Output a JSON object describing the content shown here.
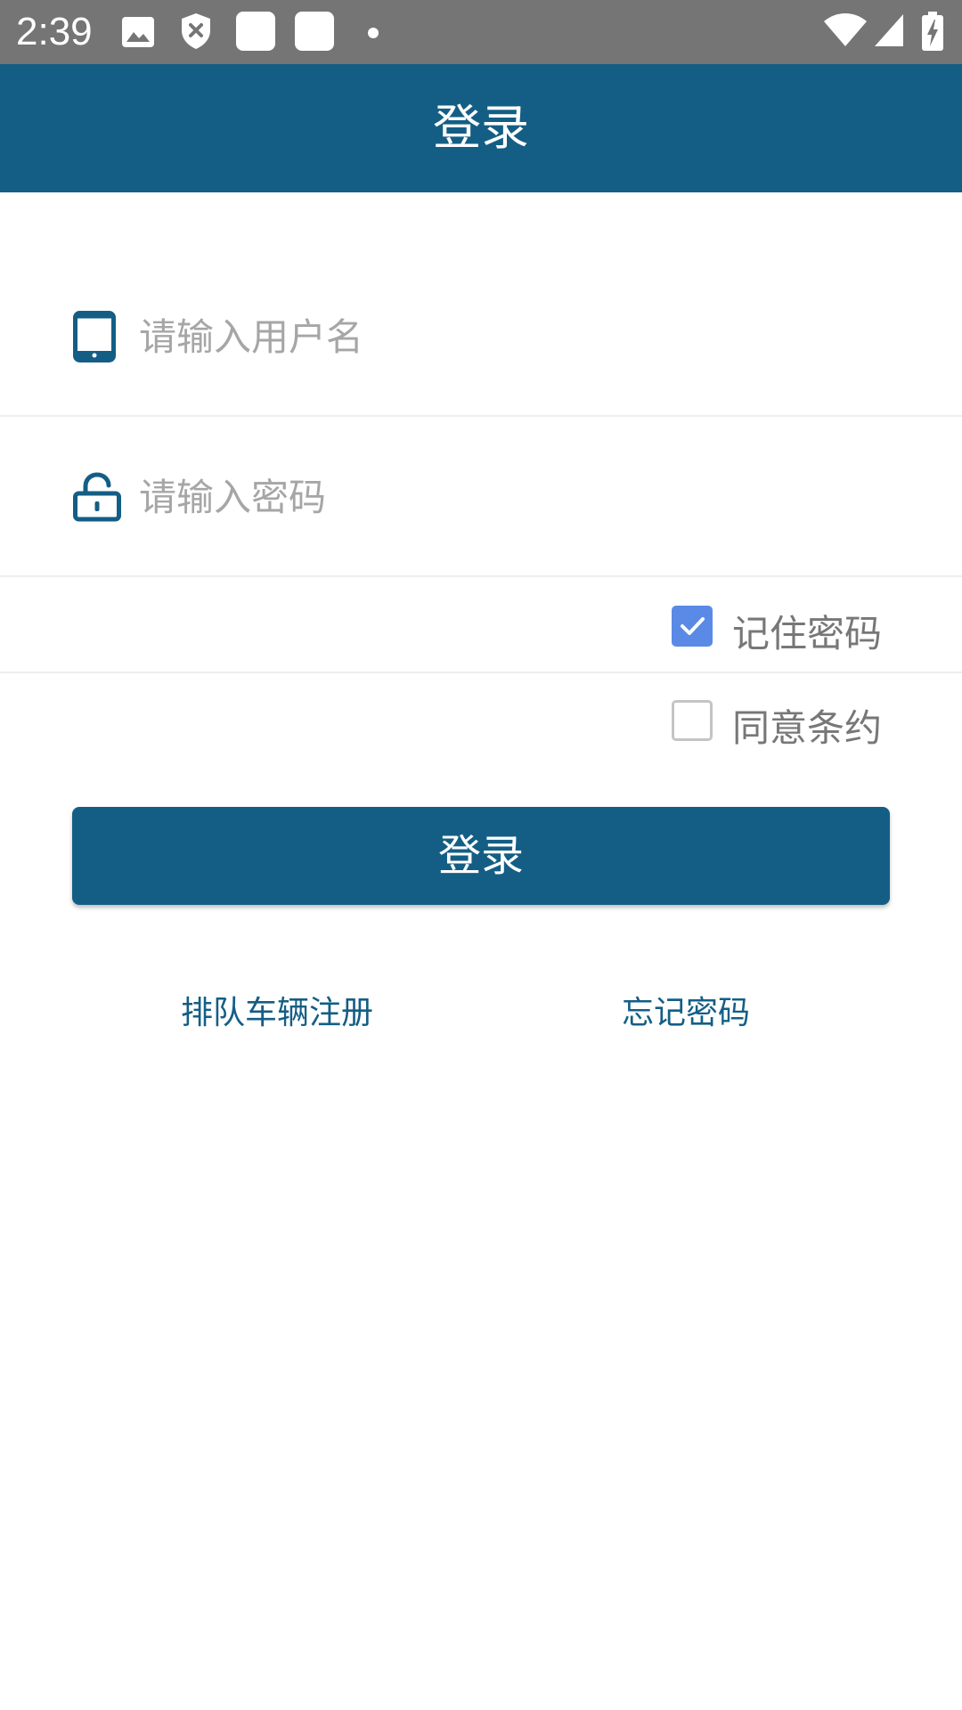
{
  "status_bar": {
    "time": "2:39",
    "icons": [
      "image-icon",
      "shield-x-icon",
      "app-square-icon",
      "app-square-icon",
      "dot-icon",
      "wifi-icon",
      "signal-icon",
      "battery-charging-icon"
    ]
  },
  "app_bar": {
    "title": "登录"
  },
  "form": {
    "username_placeholder": "请输入用户名",
    "username_value": "",
    "password_placeholder": "请输入密码",
    "password_value": "",
    "remember_label": "记住密码",
    "remember_checked": true,
    "agree_label": "同意条约",
    "agree_checked": false,
    "login_label": "登录"
  },
  "links": {
    "register": "排队车辆注册",
    "forgot": "忘记密码"
  },
  "colors": {
    "primary": "#145e85",
    "checkbox_checked": "#5a8ae6",
    "status_bar": "#757575",
    "placeholder": "#a6a6a6"
  }
}
